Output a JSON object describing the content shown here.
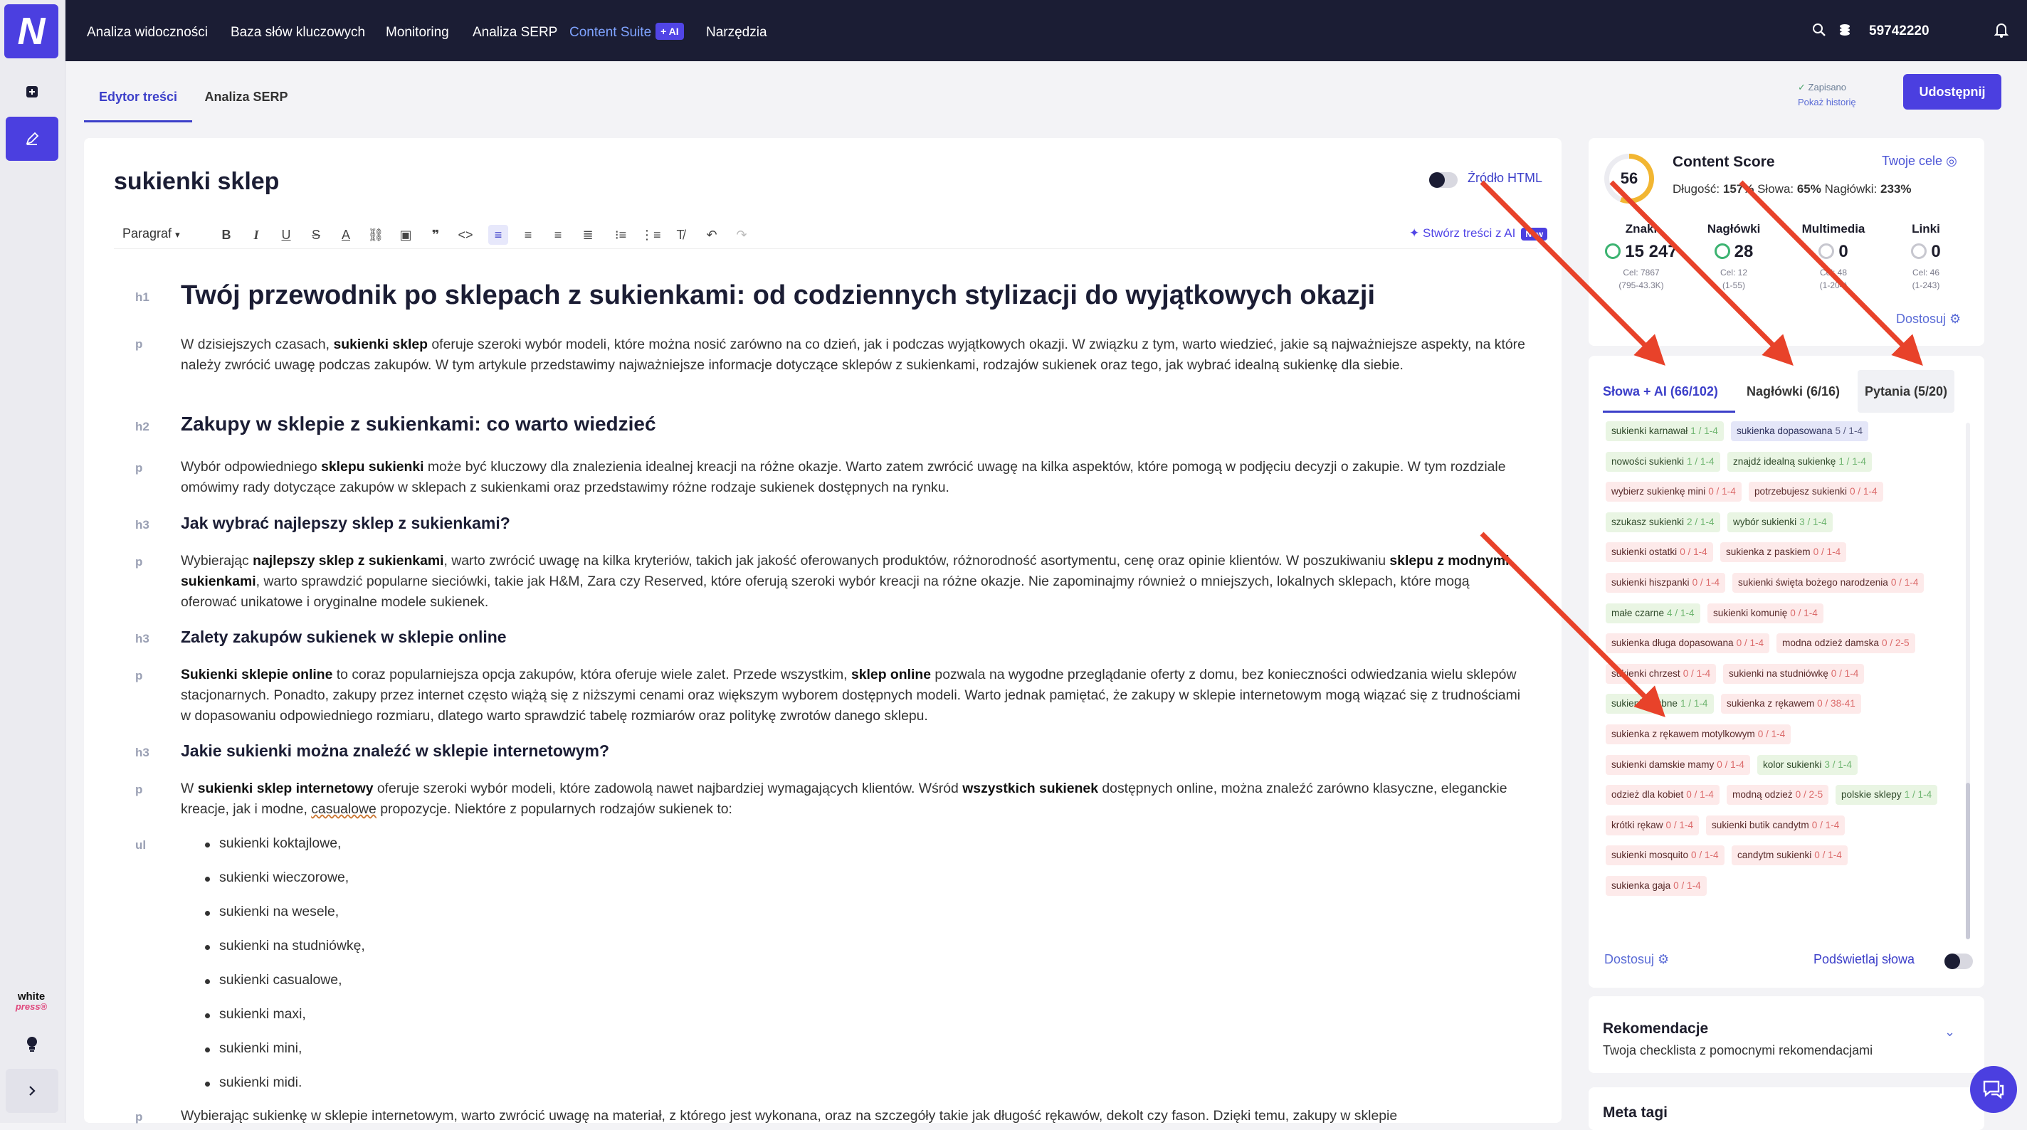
{
  "nav": {
    "logo": "N",
    "items": [
      "Analiza widoczności",
      "Baza słów kluczowych",
      "Monitoring",
      "Analiza SERP",
      "Content Suite",
      "Narzędzia"
    ],
    "ai_tag": "+ AI",
    "credits": "59742220"
  },
  "rail": {
    "wp_line1": "white",
    "wp_line2": "press®"
  },
  "subtabs": {
    "editor": "Edytor treści",
    "serp": "Analiza SERP"
  },
  "status": {
    "saved": "Zapisano",
    "history": "Pokaż historię"
  },
  "share_label": "Udostępnij",
  "editor": {
    "title": "sukienki sklep",
    "html_source": "Źródło HTML",
    "paragraph_select": "Paragraf",
    "gen_ai": "Stwórz treści z AI",
    "new_badge": "New",
    "tags": [
      "h1",
      "p",
      "h2",
      "p",
      "h3",
      "p",
      "h3",
      "p",
      "h3",
      "p",
      "ul",
      "p"
    ],
    "h1": "Twój przewodnik po sklepach z sukienkami: od codziennych stylizacji do wyjątkowych okazji",
    "p1_a": "W dzisiejszych czasach, ",
    "p1_b": "sukienki sklep",
    "p1_c": " oferuje szeroki wybór modeli, które można nosić zarówno na co dzień, jak i podczas wyjątkowych okazji. W związku z tym, warto wiedzieć, jakie są najważniejsze aspekty, na które należy zwrócić uwagę podczas zakupów. W tym artykule przedstawimy najważniejsze informacje dotyczące sklepów z sukienkami, rodzajów sukienek oraz tego, jak wybrać idealną sukienkę dla siebie.",
    "h2": "Zakupy w sklepie z sukienkami: co warto wiedzieć",
    "p2_a": "Wybór odpowiedniego ",
    "p2_b": "sklepu sukienki",
    "p2_c": " może być kluczowy dla znalezienia idealnej kreacji na różne okazje. Warto zatem zwrócić uwagę na kilka aspektów, które pomogą w podjęciu decyzji o zakupie. W tym rozdziale omówimy rady dotyczące zakupów w sklepach z sukienkami oraz przedstawimy różne rodzaje sukienek dostępnych na rynku.",
    "h3a": "Jak wybrać najlepszy sklep z sukienkami?",
    "p3_a": "Wybierając ",
    "p3_b": "najlepszy sklep z sukienkami",
    "p3_c": ", warto zwrócić uwagę na kilka kryteriów, takich jak jakość oferowanych produktów, różnorodność asortymentu, cenę oraz opinie klientów. W poszukiwaniu ",
    "p3_d": "sklepu z modnymi sukienkami",
    "p3_e": ", warto sprawdzić popularne sieciówki, takie jak H&M, Zara czy Reserved, które oferują szeroki wybór kreacji na różne okazje. Nie zapominajmy również o mniejszych, lokalnych sklepach, które mogą oferować unikatowe i oryginalne modele sukienek.",
    "h3b": "Zalety zakupów sukienek w sklepie online",
    "p4_a": "Sukienki sklepie online",
    "p4_b": " to coraz popularniejsza opcja zakupów, która oferuje wiele zalet. Przede wszystkim, ",
    "p4_c": "sklep online",
    "p4_d": " pozwala na wygodne przeglądanie oferty z domu, bez konieczności odwiedzania wielu sklepów stacjonarnych. Ponadto, zakupy przez internet często wiążą się z niższymi cenami oraz większym wyborem dostępnych modeli. Warto jednak pamiętać, że zakupy w sklepie internetowym mogą wiązać się z trudnościami w dopasowaniu odpowiedniego rozmiaru, dlatego warto sprawdzić tabelę rozmiarów oraz politykę zwrotów danego sklepu.",
    "h3c": "Jakie sukienki można znaleźć w sklepie internetowym?",
    "p5_a": "W ",
    "p5_b": "sukienki sklep internetowy",
    "p5_c": " oferuje szeroki wybór modeli, które zadowolą nawet najbardziej wymagających klientów. Wśród ",
    "p5_d": "wszystkich sukienek",
    "p5_e": " dostępnych online, można znaleźć zarówno klasyczne, eleganckie kreacje, jak i modne, ",
    "p5_f": "casualowe",
    "p5_g": " propozycje. Niektóre z popularnych rodzajów sukienek to:",
    "list": [
      "sukienki koktajlowe,",
      "sukienki wieczorowe,",
      "sukienki na wesele,",
      "sukienki na studniówkę,",
      "sukienki casualowe,",
      "sukienki maxi,",
      "sukienki mini,",
      "sukienki midi."
    ],
    "p6": "Wybierając sukienkę w sklepie internetowym, warto zwrócić uwagę na materiał, z którego jest wykonana, oraz na szczegóły takie jak długość rękawów, dekolt czy fason. Dzięki temu, zakupy w sklepie"
  },
  "score": {
    "value": "56",
    "value_fraction": 0.56,
    "title": "Content Score",
    "goals": "Twoje cele",
    "sub_len_label": "Długość: ",
    "sub_len": "157%",
    "sub_words_label": "Słowa: ",
    "sub_words": "65%",
    "sub_heads_label": "Nagłówki: ",
    "sub_heads": "233%",
    "metrics": [
      {
        "title": "Znaki",
        "value": "15 247",
        "goal": "Cel: 7867",
        "range": "(795-43.3K)",
        "status": "green"
      },
      {
        "title": "Nagłówki",
        "value": "28",
        "goal": "Cel: 12",
        "range": "(1-55)",
        "status": "green"
      },
      {
        "title": "Multimedia",
        "value": "0",
        "goal": "Cel: 48",
        "range": "(1-204)",
        "status": "gray"
      },
      {
        "title": "Linki",
        "value": "0",
        "goal": "Cel: 46",
        "range": "(1-243)",
        "status": "gray"
      }
    ],
    "adjust": "Dostosuj"
  },
  "keywords": {
    "tabs": [
      "Słowa + AI  (66/102)",
      "Nagłówki (6/16)",
      "Pytania (5/20)"
    ],
    "items": [
      {
        "t": "sukienki karnawał",
        "c": "1 / 1-4",
        "s": "green"
      },
      {
        "t": "sukienka dopasowana",
        "c": "5 / 1-4",
        "s": "blue"
      },
      {
        "t": "nowości sukienki",
        "c": "1 / 1-4",
        "s": "green"
      },
      {
        "t": "znajdź idealną sukienkę",
        "c": "1 / 1-4",
        "s": "green"
      },
      {
        "t": "wybierz sukienkę mini",
        "c": "0 / 1-4",
        "s": "red"
      },
      {
        "t": "potrzebujesz sukienki",
        "c": "0 / 1-4",
        "s": "red"
      },
      {
        "t": "szukasz sukienki",
        "c": "2 / 1-4",
        "s": "green"
      },
      {
        "t": "wybór sukienki",
        "c": "3 / 1-4",
        "s": "green"
      },
      {
        "t": "sukienki ostatki",
        "c": "0 / 1-4",
        "s": "red"
      },
      {
        "t": "sukienka z paskiem",
        "c": "0 / 1-4",
        "s": "red"
      },
      {
        "t": "sukienki hiszpanki",
        "c": "0 / 1-4",
        "s": "red"
      },
      {
        "t": "sukienki święta bożego narodzenia",
        "c": "0 / 1-4",
        "s": "red"
      },
      {
        "t": "małe czarne",
        "c": "4 / 1-4",
        "s": "green"
      },
      {
        "t": "sukienki komunię",
        "c": "0 / 1-4",
        "s": "red"
      },
      {
        "t": "sukienka długa dopasowana",
        "c": "0 / 1-4",
        "s": "red"
      },
      {
        "t": "modna odzież damska",
        "c": "0 / 2-5",
        "s": "red"
      },
      {
        "t": "sukienki chrzest",
        "c": "0 / 1-4",
        "s": "red"
      },
      {
        "t": "sukienki na studniówkę",
        "c": "0 / 1-4",
        "s": "red"
      },
      {
        "t": "sukienki ślubne",
        "c": "1 / 1-4",
        "s": "green"
      },
      {
        "t": "sukienka z rękawem",
        "c": "0 / 38-41",
        "s": "red"
      },
      {
        "t": "sukienka z rękawem motylkowym",
        "c": "0 / 1-4",
        "s": "red"
      },
      {
        "t": "sukienki damskie mamy",
        "c": "0 / 1-4",
        "s": "red"
      },
      {
        "t": "kolor sukienki",
        "c": "3 / 1-4",
        "s": "green"
      },
      {
        "t": "odzież dla kobiet",
        "c": "0 / 1-4",
        "s": "red"
      },
      {
        "t": "modną odzież",
        "c": "0 / 2-5",
        "s": "red"
      },
      {
        "t": "polskie sklepy",
        "c": "1 / 1-4",
        "s": "green"
      },
      {
        "t": "krótki rękaw",
        "c": "0 / 1-4",
        "s": "red"
      },
      {
        "t": "sukienki butik candytm",
        "c": "0 / 1-4",
        "s": "red"
      },
      {
        "t": "sukienki mosquito",
        "c": "0 / 1-4",
        "s": "red"
      },
      {
        "t": "candytm sukienki",
        "c": "0 / 1-4",
        "s": "red"
      },
      {
        "t": "sukienka gaja",
        "c": "0 / 1-4",
        "s": "red"
      }
    ],
    "adjust": "Dostosuj",
    "highlight": "Podświetlaj słowa"
  },
  "recommendations": {
    "title": "Rekomendacje",
    "sub": "Twoja checklista z pomocnymi rekomendacjami"
  },
  "meta": {
    "title": "Meta tagi"
  },
  "colors": {
    "brand": "#4b3fe0",
    "nav_bg": "#1b1d34",
    "annotation": "#e8422a"
  }
}
